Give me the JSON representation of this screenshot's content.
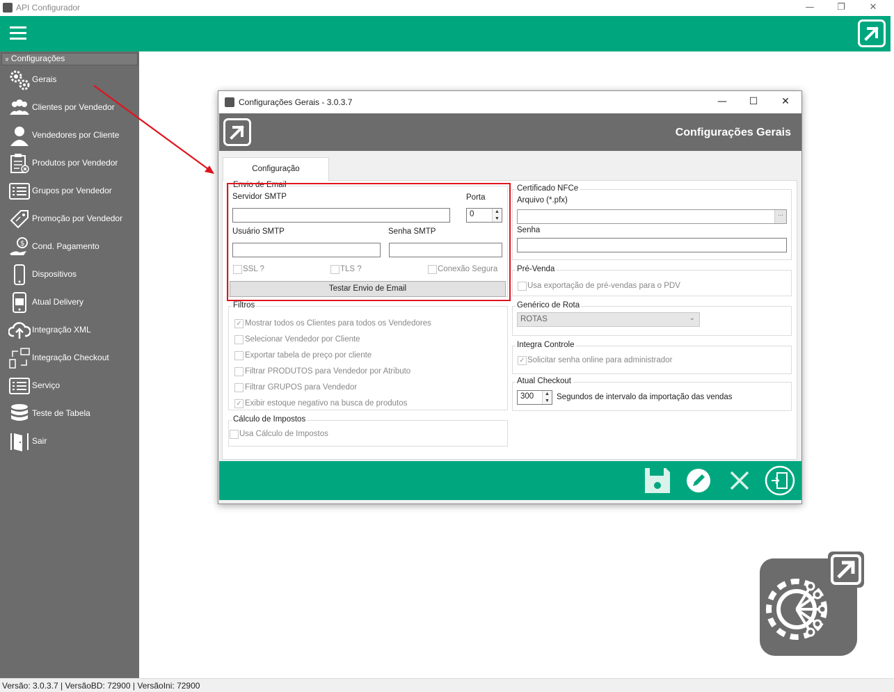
{
  "app": {
    "title": "API Configurador",
    "controls": [
      "—",
      "❐",
      "✕"
    ]
  },
  "sidebar": {
    "group_label": "Configurações",
    "group_caret": "»",
    "items": [
      {
        "label": "Gerais",
        "icon": "gears-icon"
      },
      {
        "label": "Clientes por Vendedor",
        "icon": "users-icon"
      },
      {
        "label": "Vendedores por Cliente",
        "icon": "user-icon"
      },
      {
        "label": "Produtos por Vendedor",
        "icon": "clipboard-icon"
      },
      {
        "label": "Grupos por Vendedor",
        "icon": "list-icon"
      },
      {
        "label": "Promoção por Vendedor",
        "icon": "tag-icon"
      },
      {
        "label": "Cond. Pagamento",
        "icon": "money-hand-icon"
      },
      {
        "label": "Dispositivos",
        "icon": "phone-icon"
      },
      {
        "label": "Atual Delivery",
        "icon": "phone-store-icon"
      },
      {
        "label": "Integração XML",
        "icon": "cloud-upload-icon"
      },
      {
        "label": "Integração Checkout",
        "icon": "sync-devices-icon"
      },
      {
        "label": "Serviço",
        "icon": "list-icon"
      },
      {
        "label": "Teste de Tabela",
        "icon": "database-icon"
      },
      {
        "label": "Sair",
        "icon": "door-exit-icon"
      }
    ]
  },
  "status_bar": "Versão: 3.0.3.7 | VersãoBD: 72900 | VersãoIni: 72900",
  "dialog": {
    "title": "Configurações Gerais - 3.0.3.7",
    "controls": [
      "—",
      "☐",
      "✕"
    ],
    "heading": "Configurações Gerais",
    "tab_label": "Configuração",
    "email": {
      "legend": "Envio de Email",
      "server_label": "Servidor SMTP",
      "server_value": "",
      "port_label": "Porta",
      "port_value": "0",
      "user_label": "Usuário SMTP",
      "user_value": "",
      "password_label": "Senha SMTP",
      "password_value": "",
      "ssl_label": "SSL ?",
      "tls_label": "TLS ?",
      "secure_label": "Conexão Segura",
      "test_button": "Testar Envio de Email"
    },
    "filters": {
      "legend": "Filtros",
      "options": [
        {
          "label": "Mostrar todos os Clientes para todos os Vendedores",
          "checked": true
        },
        {
          "label": "Selecionar Vendedor por Cliente",
          "checked": false
        },
        {
          "label": "Exportar tabela de preço por cliente",
          "checked": false
        },
        {
          "label": "Filtrar PRODUTOS para Vendedor por Atributo",
          "checked": false
        },
        {
          "label": "Filtrar GRUPOS para Vendedor",
          "checked": false
        },
        {
          "label": "Exibir estoque negativo na busca de produtos",
          "checked": true
        }
      ]
    },
    "taxes": {
      "legend": "Cálculo de Impostos",
      "option": "Usa Cálculo de Impostos",
      "checked": false
    },
    "nfce": {
      "legend": "Certificado NFCe",
      "file_label": "Arquivo (*.pfx)",
      "file_value": "",
      "browse": "...",
      "password_label": "Senha",
      "password_value": ""
    },
    "pre_sale": {
      "legend": "Pré-Venda",
      "option": "Usa exportação de pré-vendas para o PDV",
      "checked": false
    },
    "route": {
      "legend": "Genérico de Rota",
      "selected": "ROTAS"
    },
    "control": {
      "legend": "Integra Controle",
      "option": "Solicitar senha online para administrador",
      "checked": true
    },
    "checkout": {
      "legend": "Atual Checkout",
      "interval_value": "300",
      "interval_label": "Segundos de intervalo da importação das vendas"
    },
    "footer_buttons": [
      "save-icon",
      "edit-icon",
      "cancel-icon",
      "exit-icon"
    ]
  },
  "colors": {
    "accent": "#00a77e",
    "sidebar": "#6c6c6c",
    "highlight": "#e0141e"
  }
}
